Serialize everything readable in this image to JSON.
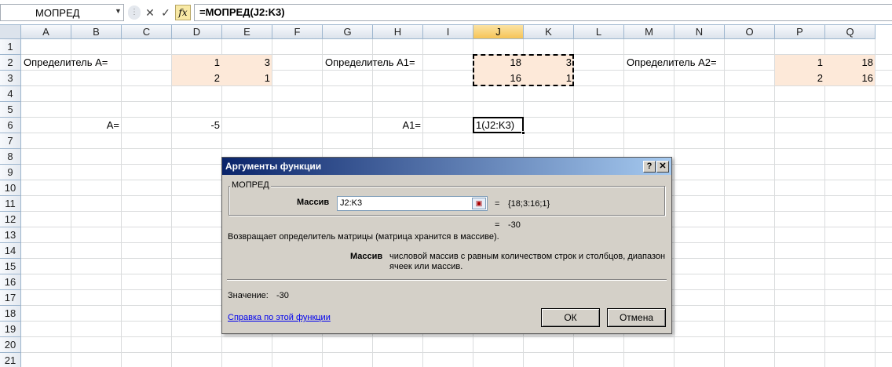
{
  "formula_bar": {
    "name_box": "МОПРЕД",
    "formula": "=МОПРЕД(J2:K3)",
    "cancel_glyph": "✕",
    "enter_glyph": "✓",
    "fx_glyph": "fx"
  },
  "columns": [
    "A",
    "B",
    "C",
    "D",
    "E",
    "F",
    "G",
    "H",
    "I",
    "J",
    "K",
    "L",
    "M",
    "N",
    "O",
    "P",
    "Q"
  ],
  "selected_column": "J",
  "rows": [
    "1",
    "2",
    "3",
    "4",
    "5",
    "6",
    "7",
    "8",
    "9",
    "10",
    "11",
    "12",
    "13",
    "14",
    "15",
    "16",
    "17",
    "18",
    "19",
    "20",
    "21",
    "22"
  ],
  "cells": {
    "A2": "Определитель  А=",
    "D2": "1",
    "E2": "3",
    "D3": "2",
    "E3": "1",
    "G2": "Определитель А1=",
    "J2": "18",
    "K2": "3",
    "J3": "16",
    "K3": "1",
    "M2": "Определитель А2=",
    "P2": "1",
    "Q2": "18",
    "P3": "2",
    "Q3": "16",
    "B6": "А=",
    "D6": "-5",
    "H6": "А1=",
    "J6": "1(J2:K3)"
  },
  "fill_color": "#fde9d9",
  "dialog": {
    "title": "Аргументы функции",
    "help_btn": "?",
    "close_btn": "✕",
    "function_name": "МОПРЕД",
    "arg_label": "Массив",
    "arg_value": "J2:K3",
    "arg_result_eq": "=",
    "arg_result": "{18;3:16;1}",
    "formula_result_eq": "=",
    "formula_result": "-30",
    "description": "Возвращает определитель матрицы (матрица хранится в массиве).",
    "param_name": "Массив",
    "param_desc_line1": "числовой массив с равным количеством строк и столбцов, диапазон",
    "param_desc_line2": "ячеек или массив.",
    "value_label": "Значение:",
    "value": "-30",
    "help_link": "Справка по этой функции",
    "ok_label": "ОК",
    "cancel_label": "Отмена"
  }
}
